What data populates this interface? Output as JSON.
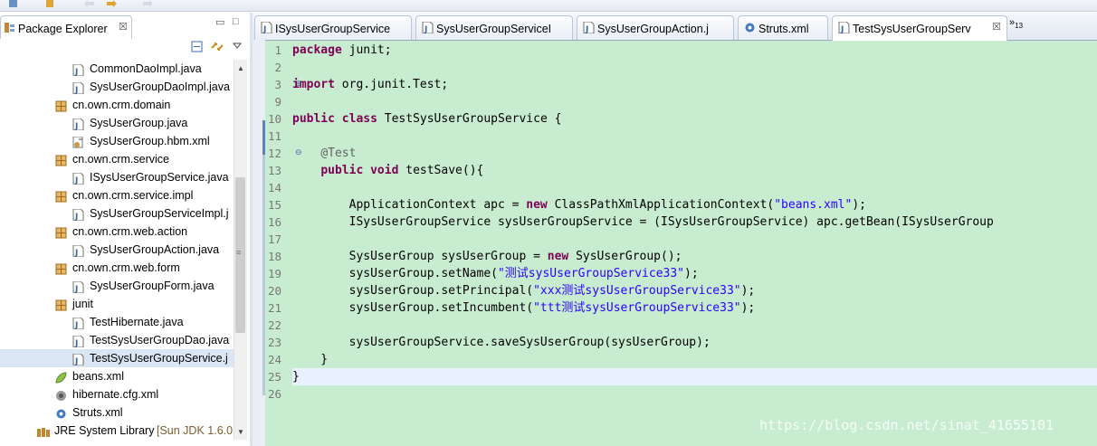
{
  "explorer": {
    "title": "Package Explorer",
    "close": "☒",
    "minimize": "▭",
    "maximize": "□",
    "tree": [
      {
        "label": "CommonDaoImpl.java",
        "type": "java",
        "indent": 99
      },
      {
        "label": "SysUserGroupDaoImpl.java",
        "type": "java",
        "indent": 99
      },
      {
        "label": "cn.own.crm.domain",
        "type": "package",
        "indent": 80
      },
      {
        "label": "SysUserGroup.java",
        "type": "java",
        "indent": 99
      },
      {
        "label": "SysUserGroup.hbm.xml",
        "type": "xml",
        "indent": 99
      },
      {
        "label": "cn.own.crm.service",
        "type": "package",
        "indent": 80
      },
      {
        "label": "ISysUserGroupService.java",
        "type": "java",
        "indent": 99
      },
      {
        "label": "cn.own.crm.service.impl",
        "type": "package",
        "indent": 80
      },
      {
        "label": "SysUserGroupServiceImpl.j",
        "type": "java",
        "indent": 99
      },
      {
        "label": "cn.own.crm.web.action",
        "type": "package",
        "indent": 80
      },
      {
        "label": "SysUserGroupAction.java",
        "type": "java",
        "indent": 99
      },
      {
        "label": "cn.own.crm.web.form",
        "type": "package",
        "indent": 80
      },
      {
        "label": "SysUserGroupForm.java",
        "type": "java",
        "indent": 99
      },
      {
        "label": "junit",
        "type": "package",
        "indent": 80
      },
      {
        "label": "TestHibernate.java",
        "type": "java",
        "indent": 99
      },
      {
        "label": "TestSysUserGroupDao.java",
        "type": "java",
        "indent": 99
      },
      {
        "label": "TestSysUserGroupService.j",
        "type": "java",
        "indent": 99,
        "selected": true
      },
      {
        "label": "beans.xml",
        "type": "spring-xml",
        "indent": 80
      },
      {
        "label": "hibernate.cfg.xml",
        "type": "hibernate-xml",
        "indent": 80
      },
      {
        "label": "Struts.xml",
        "type": "gear",
        "indent": 80
      },
      {
        "label": "JRE System Library",
        "extra": "[Sun JDK 1.6.0",
        "type": "library",
        "indent": 60
      }
    ]
  },
  "editor": {
    "tabs": [
      {
        "label": "ISysUserGroupService",
        "icon": "java-file-icon"
      },
      {
        "label": "SysUserGroupServiceI",
        "icon": "java-file-icon"
      },
      {
        "label": "SysUserGroupAction.j",
        "icon": "java-file-icon"
      },
      {
        "label": "Struts.xml",
        "icon": "gear-icon"
      },
      {
        "label": "TestSysUserGroupServ",
        "icon": "java-file-icon",
        "active": true,
        "close": "☒"
      }
    ],
    "overflow": "»",
    "overflow_count": "13",
    "lines": [
      {
        "num": "1",
        "html": "<span class=\"kw\">package</span> junit;"
      },
      {
        "num": "2",
        "html": ""
      },
      {
        "num": "3",
        "html": "<span class=\"kw\">import</span> org.junit.Test;",
        "fold": "⊕"
      },
      {
        "num": "9",
        "html": ""
      },
      {
        "num": "10",
        "html": "<span class=\"kw\">public</span> <span class=\"kw\">class</span> TestSysUserGroupService {"
      },
      {
        "num": "11",
        "html": ""
      },
      {
        "num": "12",
        "html": "    <span class=\"ann\">@Test</span>",
        "fold": "⊖"
      },
      {
        "num": "13",
        "html": "    <span class=\"kw\">public</span> <span class=\"kw\">void</span> testSave(){"
      },
      {
        "num": "14",
        "html": ""
      },
      {
        "num": "15",
        "html": "        ApplicationContext apc = <span class=\"kw\">new</span> ClassPathXmlApplicationContext(<span class=\"str\">\"beans.xml\"</span>);"
      },
      {
        "num": "16",
        "html": "        ISysUserGroupService sysUserGroupService = (ISysUserGroupService) apc.getBean(ISysUserGroup"
      },
      {
        "num": "17",
        "html": ""
      },
      {
        "num": "18",
        "html": "        SysUserGroup sysUserGroup = <span class=\"kw\">new</span> SysUserGroup();"
      },
      {
        "num": "19",
        "html": "        sysUserGroup.setName(<span class=\"str\">\"测试sysUserGroupService33\"</span>);"
      },
      {
        "num": "20",
        "html": "        sysUserGroup.setPrincipal(<span class=\"str\">\"xxx测试sysUserGroupService33\"</span>);"
      },
      {
        "num": "21",
        "html": "        sysUserGroup.setIncumbent(<span class=\"str\">\"ttt测试sysUserGroupService33\"</span>);"
      },
      {
        "num": "22",
        "html": ""
      },
      {
        "num": "23",
        "html": "        sysUserGroupService.saveSysUserGroup(sysUserGroup);"
      },
      {
        "num": "24",
        "html": "    }"
      },
      {
        "num": "25",
        "html": "}",
        "current": true
      },
      {
        "num": "26",
        "html": ""
      }
    ],
    "watermark": "https://blog.csdn.net/sinat_41655101"
  },
  "colors": {
    "keyword": "#7f0055",
    "string": "#2a00ff",
    "annotation": "#646464",
    "editor_bg": "#c8ecd0",
    "current_line": "#e8f2fe"
  }
}
